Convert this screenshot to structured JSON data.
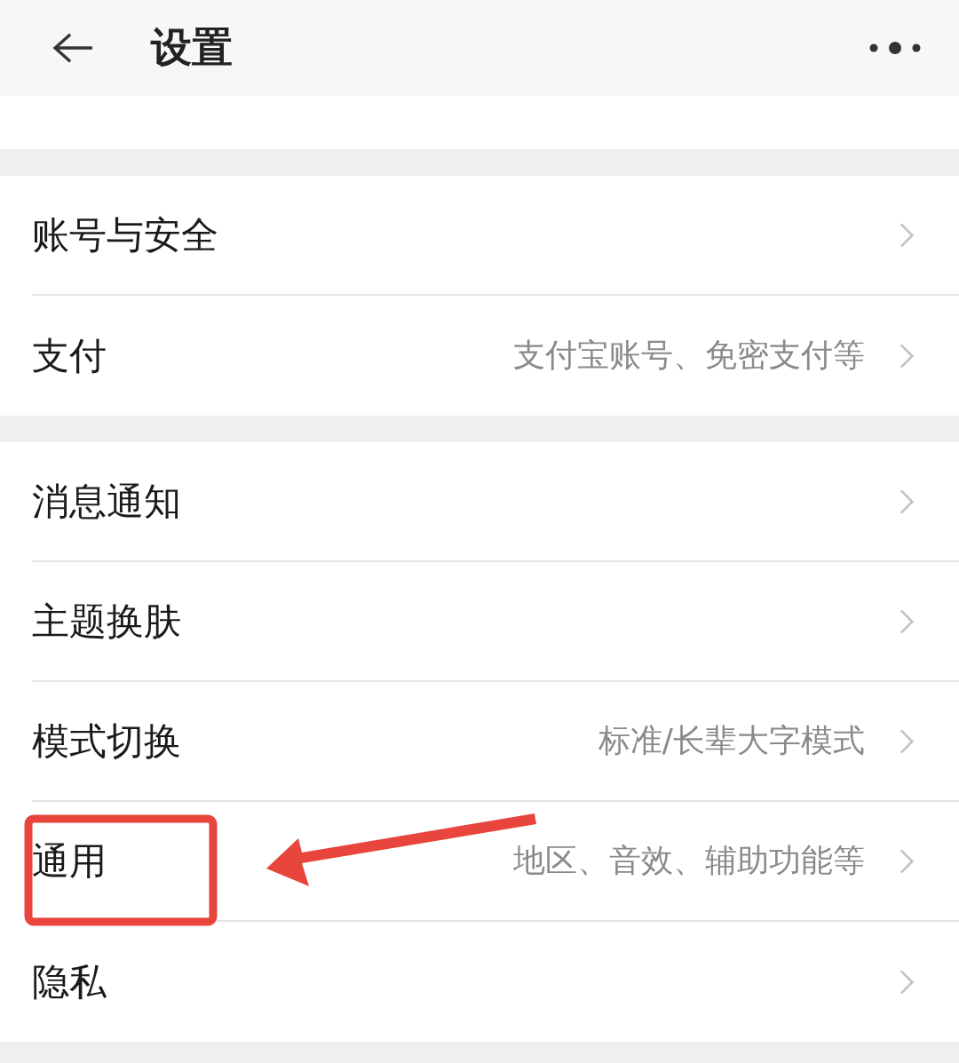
{
  "header": {
    "title": "设置"
  },
  "sections": [
    {
      "items": [
        {
          "label": "账号与安全"
        },
        {
          "label": "支付",
          "detail": "支付宝账号、免密支付等"
        }
      ]
    },
    {
      "items": [
        {
          "label": "消息通知"
        },
        {
          "label": "主题换肤"
        },
        {
          "label": "模式切换",
          "detail": "标准/长辈大字模式"
        },
        {
          "label": "通用",
          "detail": "地区、音效、辅助功能等"
        },
        {
          "label": "隐私"
        }
      ]
    }
  ]
}
